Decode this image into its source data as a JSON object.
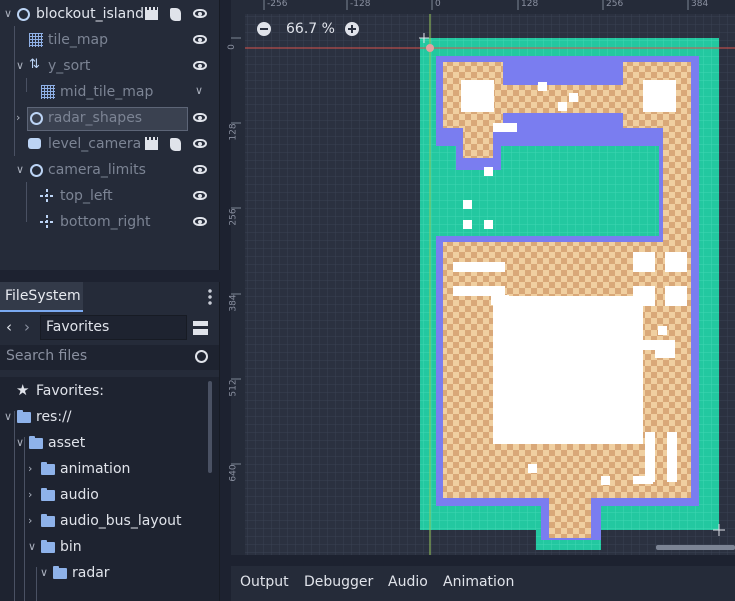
{
  "scene_tree": {
    "items": [
      {
        "label": "blockout_island"
      },
      {
        "label": "tile_map"
      },
      {
        "label": "y_sort"
      },
      {
        "label": "mid_tile_map"
      },
      {
        "label": "radar_shapes"
      },
      {
        "label": "level_camera"
      },
      {
        "label": "camera_limits"
      },
      {
        "label": "top_left"
      },
      {
        "label": "bottom_right"
      }
    ]
  },
  "filesystem": {
    "tab_label": "FileSystem",
    "path": "Favorites",
    "search_placeholder": "Search files",
    "tree": [
      {
        "label": "Favorites:"
      },
      {
        "label": "res://"
      },
      {
        "label": "asset"
      },
      {
        "label": "animation"
      },
      {
        "label": "audio"
      },
      {
        "label": "audio_bus_layout"
      },
      {
        "label": "bin"
      },
      {
        "label": "radar"
      }
    ]
  },
  "viewport": {
    "zoom": "66.7 %",
    "ruler_h": [
      "-256",
      "-128",
      "0",
      "128",
      "256",
      "384"
    ],
    "ruler_v": [
      "0",
      "128",
      "256",
      "384",
      "512",
      "640"
    ]
  },
  "bottom_panel": {
    "tabs": [
      "Output",
      "Debugger",
      "Audio",
      "Animation"
    ]
  },
  "colors": {
    "water": "#23c8a0",
    "sand_light": "#f0cfa0",
    "sand_dark": "#d9a878",
    "wall_blue": "#7a7df0",
    "accent": "#7aa9f0"
  }
}
